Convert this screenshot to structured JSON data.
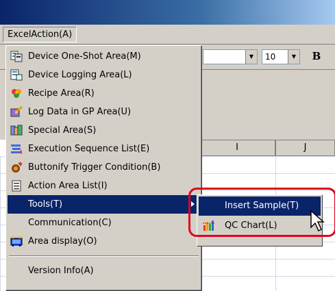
{
  "menubar": {
    "menu_label": "ExcelAction(A)"
  },
  "toolbar": {
    "font_size": "10",
    "bold_label": "B"
  },
  "grid": {
    "col_i": "I",
    "col_j": "J"
  },
  "menu": {
    "items": [
      {
        "label": "Device One-Shot Area(M)",
        "icon": "device-oneshot-icon"
      },
      {
        "label": "Device Logging Area(L)",
        "icon": "device-logging-icon"
      },
      {
        "label": "Recipe Area(R)",
        "icon": "recipe-icon"
      },
      {
        "label": "Log Data in GP Area(U)",
        "icon": "log-data-icon"
      },
      {
        "label": "Special Area(S)",
        "icon": "special-area-icon"
      },
      {
        "label": "Execution Sequence List(E)",
        "icon": "execution-sequence-icon"
      },
      {
        "label": "Buttonify Trigger Condition(B)",
        "icon": "buttonify-icon"
      },
      {
        "label": "Action Area List(I)",
        "icon": "action-list-icon"
      },
      {
        "label": "Tools(T)",
        "icon": ""
      },
      {
        "label": "Communication(C)",
        "icon": ""
      },
      {
        "label": "Area display(O)",
        "icon": "area-display-icon"
      },
      {
        "label": "Version Info(A)",
        "icon": ""
      }
    ]
  },
  "submenu": {
    "items": [
      {
        "label": "Insert Sample(T)"
      },
      {
        "label": "QC Chart(L)",
        "icon": "qc-chart-icon"
      }
    ]
  },
  "colors": {
    "menu_highlight": "#0a246a",
    "annotation_box": "#e0001a"
  }
}
